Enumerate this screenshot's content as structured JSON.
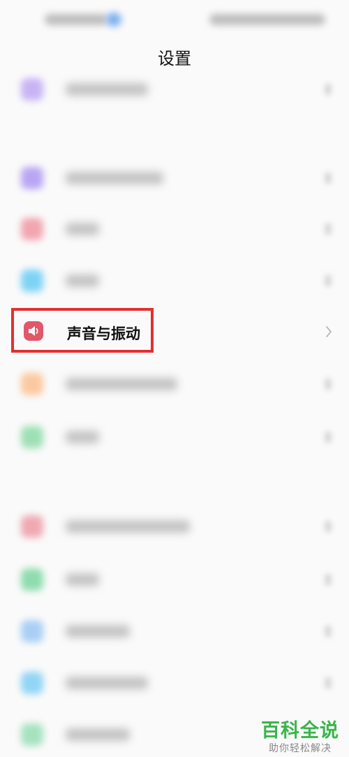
{
  "header": {
    "title": "设置"
  },
  "highlighted_item": {
    "label": "声音与振动",
    "icon": "speaker-icon"
  },
  "colors": {
    "highlight_border": "#e23030",
    "sound_icon_bg": "#e2576a",
    "watermark_green": "#39b54a"
  },
  "watermark": {
    "brand": "百科全说",
    "slogan": "助你轻松解决"
  }
}
